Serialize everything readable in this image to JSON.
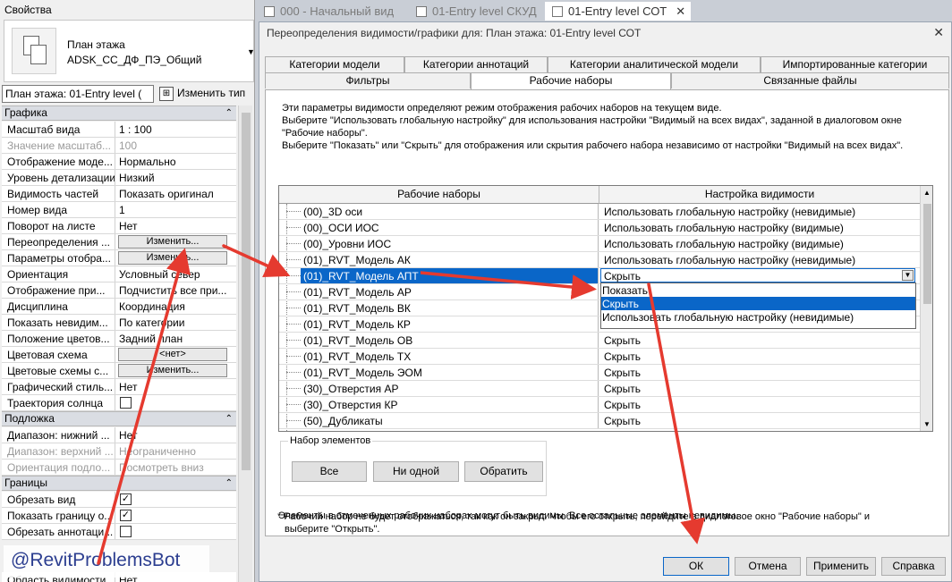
{
  "properties": {
    "title": "Свойства",
    "type_name_line1": "План этажа",
    "type_name_line2": "ADSK_СС_ДФ_ПЭ_Общий",
    "view_selector": "План этажа: 01-Entry level (",
    "edit_type": "Изменить тип",
    "groups": {
      "graphics": "Графика",
      "underlay": "Подложка",
      "extents": "Границы"
    },
    "rows": [
      {
        "k": "Масштаб вида",
        "v": "1 : 100"
      },
      {
        "k": "Значение масштаб...",
        "v": "100"
      },
      {
        "k": "Отображение моде...",
        "v": "Нормально"
      },
      {
        "k": "Уровень детализации",
        "v": "Низкий"
      },
      {
        "k": "Видимость частей",
        "v": "Показать оригинал"
      },
      {
        "k": "Номер вида",
        "v": "1"
      },
      {
        "k": "Поворот на листе",
        "v": "Нет"
      },
      {
        "k": "Переопределения ...",
        "v": "Изменить..."
      },
      {
        "k": "Параметры отобра...",
        "v": "Изменить..."
      },
      {
        "k": "Ориентация",
        "v": "Условный север"
      },
      {
        "k": "Отображение при...",
        "v": "Подчистить все при..."
      },
      {
        "k": "Дисциплина",
        "v": "Координация"
      },
      {
        "k": "Показать невидим...",
        "v": "По категории"
      },
      {
        "k": "Положение цветов...",
        "v": "Задний план"
      },
      {
        "k": "Цветовая схема",
        "v": "<нет>"
      },
      {
        "k": "Цветовые схемы с...",
        "v": "Изменить..."
      },
      {
        "k": "Графический стиль...",
        "v": "Нет"
      },
      {
        "k": "Траектория солнца",
        "v": ""
      },
      {
        "k": "Диапазон: нижний ...",
        "v": "Нет"
      },
      {
        "k": "Диапазон: верхний ...",
        "v": "Неограниченно"
      },
      {
        "k": "Ориентация подло...",
        "v": "Посмотреть вниз"
      },
      {
        "k": "Обрезать вид",
        "v": ""
      },
      {
        "k": "Показать границу о...",
        "v": ""
      },
      {
        "k": "Обрезать аннотаци...",
        "v": ""
      },
      {
        "k": "Область видимости",
        "v": "Нет"
      }
    ],
    "watermark": "@RevitProblemsBot"
  },
  "view_tabs": [
    {
      "label": "000 - Начальный вид"
    },
    {
      "label": "01-Entry level СКУД"
    },
    {
      "label": "01-Entry level СОТ",
      "close": "✕"
    }
  ],
  "dialog": {
    "title": "Переопределения видимости/графики для: План этажа: 01-Entry level СОТ",
    "close": "✕",
    "tabs_row1": [
      "Категории модели",
      "Категории аннотаций",
      "Категории аналитической модели",
      "Импортированные категории"
    ],
    "tabs_row2": [
      "Фильтры",
      "Рабочие наборы",
      "Связанные файлы"
    ],
    "info": [
      "Эти параметры видимости определяют режим отображения рабочих наборов на текущем виде.",
      "Выберите \"Использовать глобальную настройку\" для использования настройки \"Видимый на всех видах\", заданной в диалоговом окне",
      "\"Рабочие наборы\".",
      "Выберите \"Показать\" или \"Скрыть\" для отображения или скрытия рабочего набора независимо от настройки \"Видимый на всех видах\"."
    ],
    "grid": {
      "col1": "Рабочие наборы",
      "col2": "Настройка видимости",
      "rows": [
        {
          "name": "(00)_3D оси",
          "vis": "Использовать глобальную настройку (невидимые)"
        },
        {
          "name": "(00)_ОСИ ИОС",
          "vis": "Использовать глобальную настройку (видимые)"
        },
        {
          "name": "(00)_Уровни ИОС",
          "vis": "Использовать глобальную настройку (видимые)"
        },
        {
          "name": "(01)_RVT_Модель АК",
          "vis": "Использовать глобальную настройку (невидимые)"
        },
        {
          "name": "(01)_RVT_Модель АПТ",
          "vis": "Скрыть"
        },
        {
          "name": "(01)_RVT_Модель АР",
          "vis": ""
        },
        {
          "name": "(01)_RVT_Модель ВК",
          "vis": ""
        },
        {
          "name": "(01)_RVT_Модель КР",
          "vis": ""
        },
        {
          "name": "(01)_RVT_Модель ОВ",
          "vis": "Скрыть"
        },
        {
          "name": "(01)_RVT_Модель ТХ",
          "vis": "Скрыть"
        },
        {
          "name": "(01)_RVT_Модель ЭОМ",
          "vis": "Скрыть"
        },
        {
          "name": "(30)_Отверстия АР",
          "vis": "Скрыть"
        },
        {
          "name": "(30)_Отверстия КР",
          "vis": "Скрыть"
        },
        {
          "name": "(50)_Дубликаты",
          "vis": "Скрыть"
        }
      ],
      "dropdown_options": [
        "Показать",
        "Скрыть",
        "Использовать глобальную настройку (невидимые)"
      ]
    },
    "set_group": {
      "legend": "Набор элементов",
      "all": "Все",
      "none": "Ни одной",
      "invert": "Обратить"
    },
    "note1": "Элементы в отмеченных рабочих наборах могут быть видимы.  Все остальные элементы невидимы.",
    "note2a": "* Рабочий набор не будет отображаться, так как он закрыт. Чтобы его открыть, перейдите в диалоговое окно \"Рабочие наборы\" и",
    "note2b": "выберите \"Открыть\".",
    "buttons": {
      "ok": "ОК",
      "cancel": "Отмена",
      "apply": "Применить",
      "help": "Справка"
    }
  },
  "colors": {
    "selection": "#0a66c8",
    "annotation_arrow": "#e53a2f"
  }
}
